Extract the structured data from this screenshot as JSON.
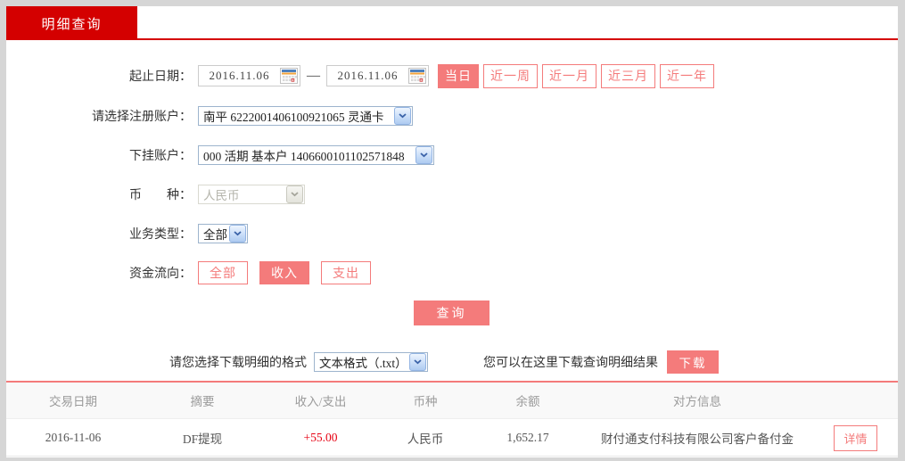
{
  "colors": {
    "brand-red": "#d40000",
    "accent": "#f47b7b",
    "amount-red": "#e60012",
    "header-gray": "#9b9b9b"
  },
  "tab": {
    "label": "明细查询"
  },
  "form": {
    "date_row": {
      "label": "起止日期：",
      "start": "2016.11.06",
      "separator": "—",
      "end": "2016.11.06",
      "quick_buttons": [
        {
          "label": "当日",
          "active": true
        },
        {
          "label": "近一周",
          "active": false
        },
        {
          "label": "近一月",
          "active": false
        },
        {
          "label": "近三月",
          "active": false
        },
        {
          "label": "近一年",
          "active": false
        }
      ]
    },
    "registered_account": {
      "label": "请选择注册账户：",
      "value": "南平 6222001406100921065 灵通卡"
    },
    "sub_account": {
      "label": "下挂账户：",
      "value": "000 活期 基本户 1406600101102571848"
    },
    "currency": {
      "label": "币　　种：",
      "value": "人民币",
      "disabled": true
    },
    "business_type": {
      "label": "业务类型：",
      "value": "全部"
    },
    "fund_flow": {
      "label": "资金流向：",
      "buttons": [
        {
          "label": "全部",
          "active": false
        },
        {
          "label": "收入",
          "active": true
        },
        {
          "label": "支出",
          "active": false
        }
      ]
    },
    "query_button": "查询"
  },
  "download": {
    "label": "请您选择下载明细的格式",
    "format_value": "文本格式（.txt）",
    "hint": "您可以在这里下载查询明细结果",
    "button": "下载"
  },
  "table": {
    "headers": [
      "交易日期",
      "摘要",
      "收入/支出",
      "币种",
      "余额",
      "对方信息"
    ],
    "rows": [
      {
        "date": "2016-11-06",
        "summary": "DF提现",
        "amount": "+55.00",
        "currency": "人民币",
        "balance": "1,652.17",
        "counterparty": "财付通支付科技有限公司客户备付金",
        "detail_button": "详情"
      }
    ]
  }
}
